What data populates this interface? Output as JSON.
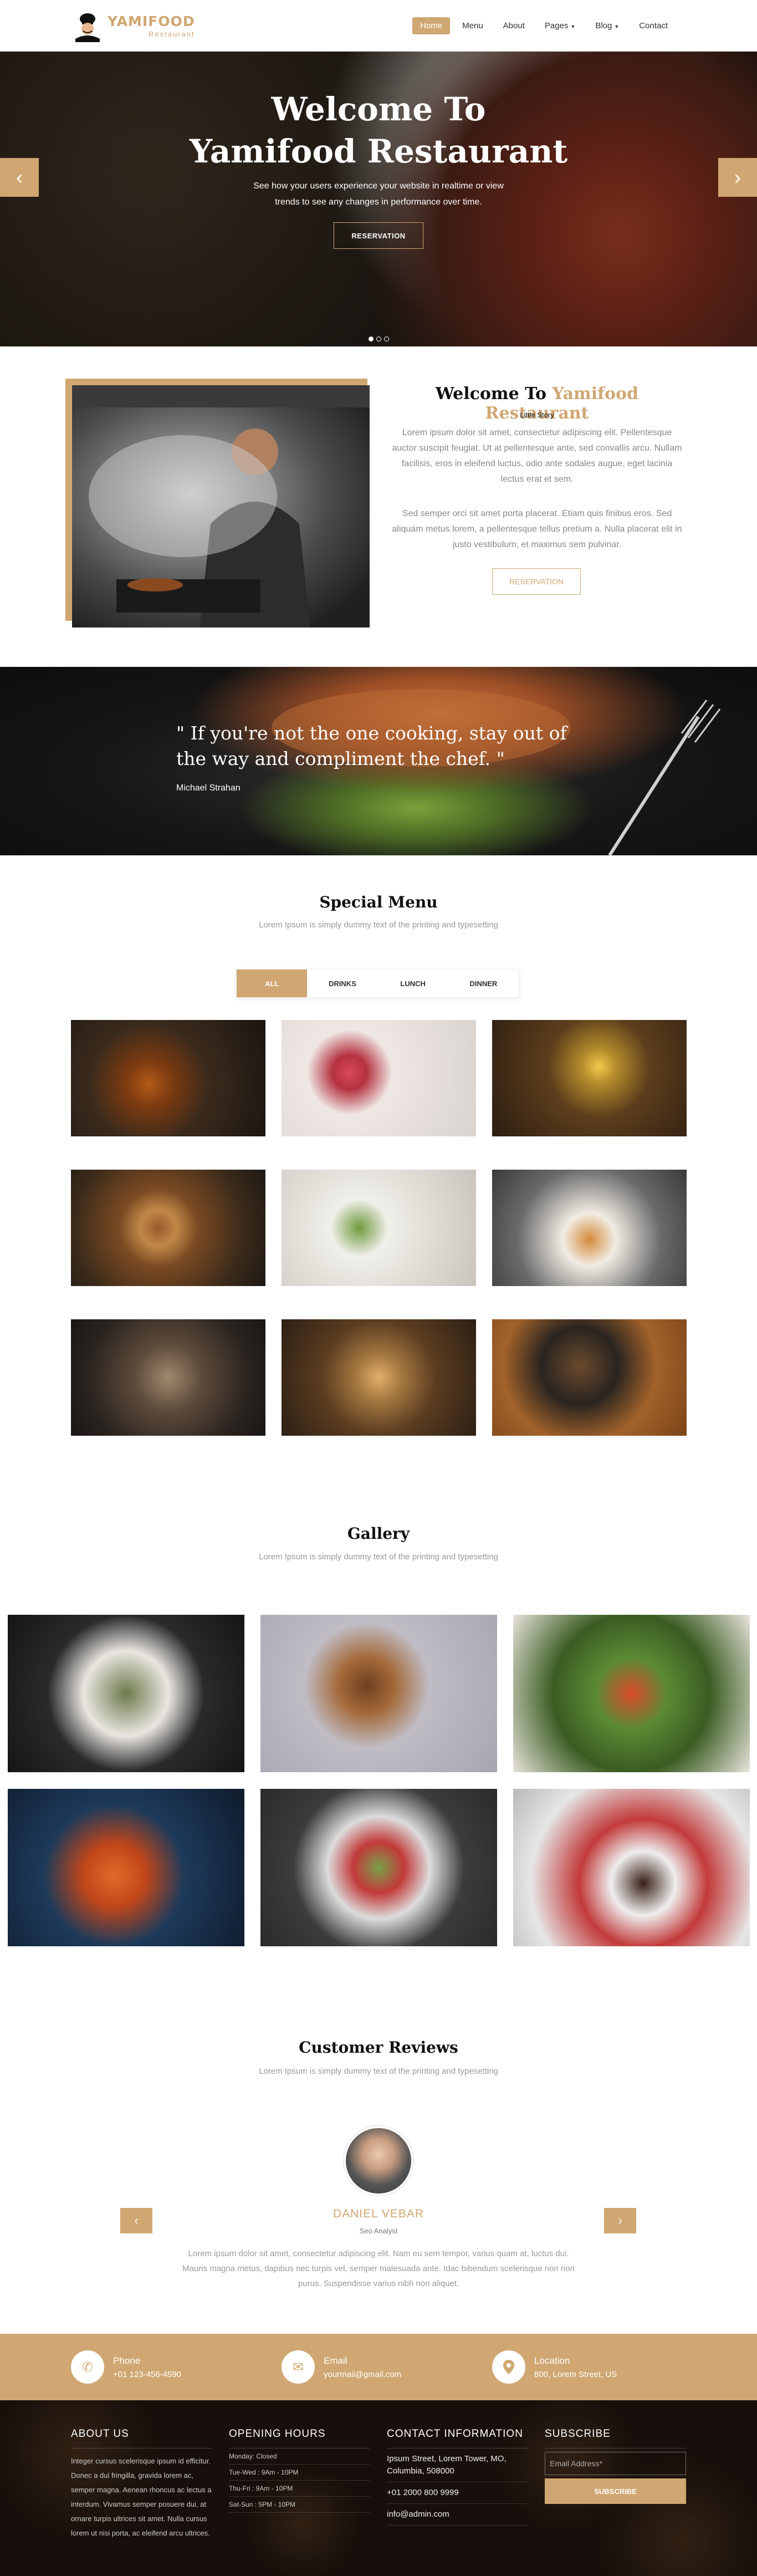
{
  "header": {
    "logo_title": "YAMIFOOD",
    "logo_sub": "Restaurant",
    "nav": [
      {
        "label": "Home",
        "active": true
      },
      {
        "label": "Menu"
      },
      {
        "label": "About"
      },
      {
        "label": "Pages",
        "dropdown": true
      },
      {
        "label": "Blog",
        "dropdown": true
      },
      {
        "label": "Contact"
      }
    ]
  },
  "hero": {
    "title_line1": "Welcome To",
    "title_line2": "Yamifood Restaurant",
    "text": "See how your users experience your website in realtime or view trends to see any changes in performance over time.",
    "button": "RESERVATION",
    "prev_icon": "‹",
    "next_icon": "›",
    "slides": 3,
    "active_slide": 1
  },
  "about": {
    "title_plain": "Welcome To ",
    "title_highlight": "Yamifood Restaurant",
    "subtitle": "Little Story",
    "p1": "Lorem ipsum dolor sit amet, consectetur adipiscing elit. Pellentesque auctor suscipit feugiat. Ut at pellentesque ante, sed convallis arcu. Nullam facilisis, eros in eleifend luctus, odio ante sodales augue, eget lacinia lectus erat et sem.",
    "p2": "Sed semper orci sit amet porta placerat. Etiam quis finibus eros. Sed aliquam metus lorem, a pellentesque tellus pretium a. Nulla placerat elit in justo vestibulum, et maximus sem pulvinar.",
    "button": "RESERVATION"
  },
  "quote": {
    "text": "\" If you're not the one cooking, stay out of the way and compliment the chef. \"",
    "author": "Michael Strahan"
  },
  "menu": {
    "title": "Special Menu",
    "subtitle": "Lorem Ipsum is simply dummy text of the printing and typesetting",
    "tabs": [
      "ALL",
      "DRINKS",
      "LUNCH",
      "DINNER"
    ],
    "active_tab": "ALL"
  },
  "gallery": {
    "title": "Gallery",
    "subtitle": "Lorem Ipsum is simply dummy text of the printing and typesetting"
  },
  "reviews": {
    "title": "Customer Reviews",
    "subtitle": "Lorem Ipsum is simply dummy text of the printing and typesetting",
    "name": "DANIEL VEBAR",
    "role": "Seo Analyst",
    "text": "Lorem ipsum dolor sit amet, consectetur adipiscing elit. Nam eu sem tempor, varius quam at, luctus dui. Mauris magna metus, dapibus nec turpis vel, semper malesuada ante. Idac bibendum scelerisque non non purus. Suspendisse varius nibh non aliquet.",
    "prev_icon": "‹",
    "next_icon": "›"
  },
  "contact_bar": {
    "phone_label": "Phone",
    "phone_value": "+01 123-456-4590",
    "email_label": "Email",
    "email_value": "yourmail@gmail.com",
    "location_label": "Location",
    "location_value": "800, Lorem Street, US"
  },
  "footer": {
    "about_head": "ABOUT US",
    "about_text": "Integer cursus scelerisque ipsum id efficitur. Donec a dui fringilla, gravida lorem ac, semper magna. Aenean rhoncus ac lectus a interdum. Vivamus semper posuere dui, at ornare turpis ultrices sit amet. Nulla cursus lorem ut nisi porta, ac eleifend arcu ultrices.",
    "hours_head": "OPENING HOURS",
    "hours": [
      "Monday: Closed",
      "Tue-Wed : 9Am - 10PM",
      "Thu-Fri : 9Am - 10PM",
      "Sat-Sun : 5PM - 10PM"
    ],
    "contact_head": "CONTACT INFORMATION",
    "contact_address": "Ipsum Street, Lorem Tower, MO, Columbia, 508000",
    "contact_phone": "+01 2000 800 9999",
    "contact_email": "info@admin.com",
    "subscribe_head": "SUBSCRIBE",
    "subscribe_placeholder": "Email Address*",
    "subscribe_button": "SUBSCRIBE",
    "social": [
      "facebook-icon",
      "twitter-icon",
      "linkedin-icon",
      "google-plus-icon",
      "instagram-icon"
    ]
  },
  "colors": {
    "accent": "#d0a772"
  }
}
